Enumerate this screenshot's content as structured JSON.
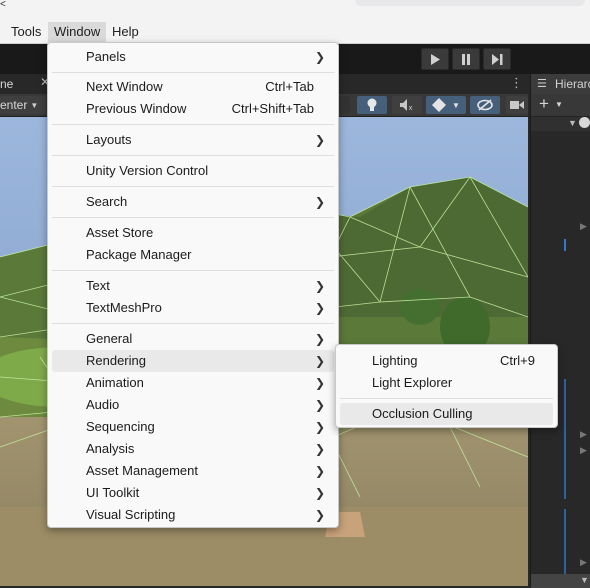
{
  "menubar": {
    "items": [
      {
        "label": "Tools"
      },
      {
        "label": "Window"
      },
      {
        "label": "Help"
      }
    ]
  },
  "scene_tab": {
    "label_partial": "ne",
    "pivot_label_partial": "enter"
  },
  "hierarchy": {
    "tab_label": "Hierarc"
  },
  "window_menu": {
    "items": [
      {
        "label": "Panels",
        "shortcut": "",
        "submenu": true
      },
      {
        "label": "Next Window",
        "shortcut": "Ctrl+Tab",
        "submenu": false
      },
      {
        "label": "Previous Window",
        "shortcut": "Ctrl+Shift+Tab",
        "submenu": false
      },
      {
        "label": "Layouts",
        "shortcut": "",
        "submenu": true
      },
      {
        "label": "Unity Version Control",
        "shortcut": "",
        "submenu": false
      },
      {
        "label": "Search",
        "shortcut": "",
        "submenu": true
      },
      {
        "label": "Asset Store",
        "shortcut": "",
        "submenu": false
      },
      {
        "label": "Package Manager",
        "shortcut": "",
        "submenu": false
      },
      {
        "label": "Text",
        "shortcut": "",
        "submenu": true
      },
      {
        "label": "TextMeshPro",
        "shortcut": "",
        "submenu": true
      },
      {
        "label": "General",
        "shortcut": "",
        "submenu": true
      },
      {
        "label": "Rendering",
        "shortcut": "",
        "submenu": true
      },
      {
        "label": "Animation",
        "shortcut": "",
        "submenu": true
      },
      {
        "label": "Audio",
        "shortcut": "",
        "submenu": true
      },
      {
        "label": "Sequencing",
        "shortcut": "",
        "submenu": true
      },
      {
        "label": "Analysis",
        "shortcut": "",
        "submenu": true
      },
      {
        "label": "Asset Management",
        "shortcut": "",
        "submenu": true
      },
      {
        "label": "UI Toolkit",
        "shortcut": "",
        "submenu": true
      },
      {
        "label": "Visual Scripting",
        "shortcut": "",
        "submenu": true
      }
    ]
  },
  "rendering_submenu": {
    "items": [
      {
        "label": "Lighting",
        "shortcut": "Ctrl+9"
      },
      {
        "label": "Light Explorer",
        "shortcut": ""
      },
      {
        "label": "Occlusion Culling",
        "shortcut": ""
      }
    ]
  },
  "icons": {
    "play": "play-icon",
    "pause": "pause-icon",
    "step": "step-icon",
    "submenu_arrow": "chevron-right-icon"
  },
  "colors": {
    "menu_bg": "#f9f9f9",
    "highlight": "#e9e9e9",
    "editor_dark": "#282828",
    "wireframe": "#9be86a"
  }
}
